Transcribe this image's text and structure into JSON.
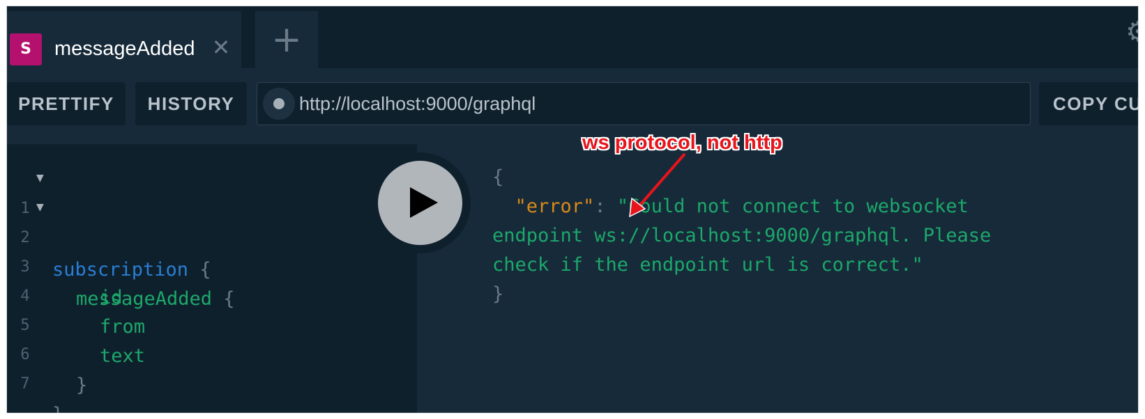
{
  "tabs": {
    "active": {
      "badge": "S",
      "title": "messageAdded",
      "close_glyph": "✕"
    },
    "add_glyph": "+",
    "settings_icon": "gear-icon"
  },
  "toolbar": {
    "prettify_label": "PRETTIFY",
    "history_label": "HISTORY",
    "endpoint_url": "http://localhost:9000/graphql",
    "copy_curl_label": "COPY CURL"
  },
  "query_editor": {
    "lines": [
      {
        "number": "1",
        "text": "subscription",
        "brace": " {"
      },
      {
        "number": "2",
        "text": "messageAdded",
        "brace": " {"
      },
      {
        "number": "3",
        "text": "id"
      },
      {
        "number": "4",
        "text": "from"
      },
      {
        "number": "5",
        "text": "text"
      },
      {
        "number": "6",
        "brace": "}"
      },
      {
        "number": "7",
        "brace": "}"
      }
    ],
    "fold_glyph": "▼"
  },
  "result": {
    "open_brace": "{",
    "key": "\"error\"",
    "colon": ": ",
    "message": "\"Could not connect to websocket endpoint ws://localhost:9000/graphql. Please check if the endpoint url is correct.\"",
    "close_brace": "}"
  },
  "annotation": {
    "text": "ws protocol, not http",
    "color": "#e8141c"
  },
  "colors": {
    "background": "#172a3a",
    "tab_badge": "#b3116d",
    "keyword": "#2a7ed3",
    "field": "#1ca86a",
    "json_key": "#d98a19"
  }
}
